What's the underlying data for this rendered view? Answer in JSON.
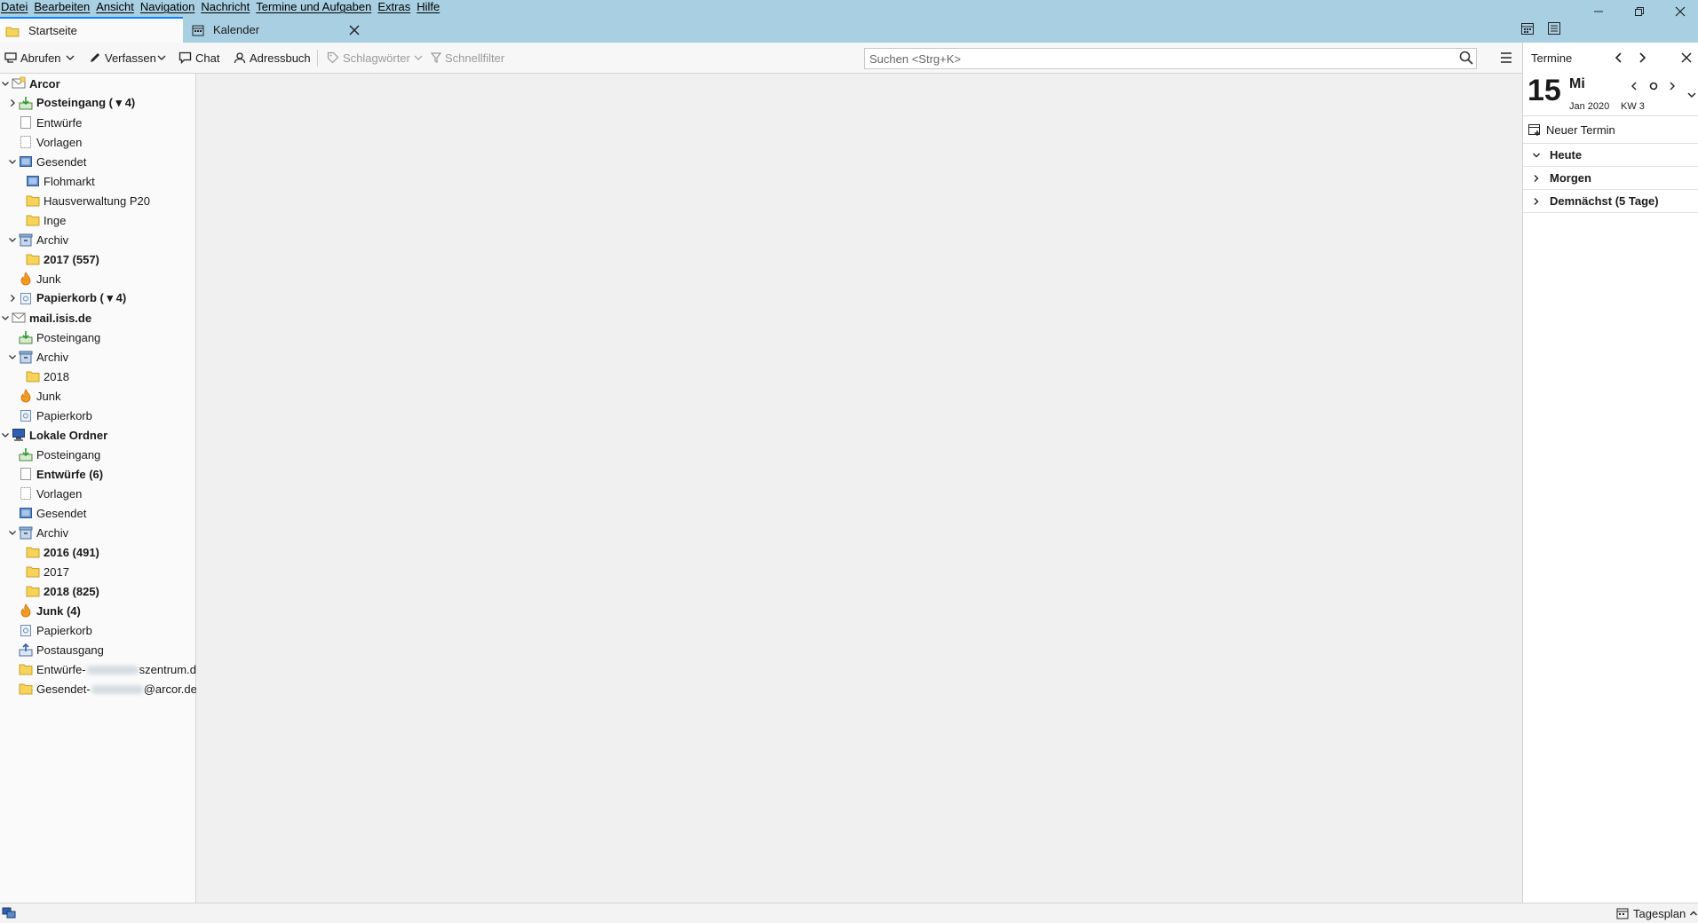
{
  "menu": [
    "Datei",
    "Bearbeiten",
    "Ansicht",
    "Navigation",
    "Nachricht",
    "Termine und Aufgaben",
    "Extras",
    "Hilfe"
  ],
  "tabs": [
    {
      "label": "Startseite",
      "icon": "folder-icon"
    },
    {
      "label": "Kalender",
      "icon": "calendar-icon"
    }
  ],
  "toolbar": {
    "abrufen": "Abrufen",
    "verfassen": "Verfassen",
    "chat": "Chat",
    "adressbuch": "Adressbuch",
    "schlagwoerter": "Schlagwörter",
    "schnellfilter": "Schnellfilter"
  },
  "search": {
    "placeholder": "Suchen <Strg+K>"
  },
  "folders": [
    {
      "label": "Arcor",
      "bold": true
    },
    {
      "label": "Posteingang ( ▾ 4)",
      "bold": true
    },
    {
      "label": "Entwürfe",
      "bold": false
    },
    {
      "label": "Vorlagen",
      "bold": false
    },
    {
      "label": "Gesendet",
      "bold": false
    },
    {
      "label": "Flohmarkt",
      "bold": false
    },
    {
      "label": "Hausverwaltung P20",
      "bold": false
    },
    {
      "label": "Inge",
      "bold": false
    },
    {
      "label": "Archiv",
      "bold": false
    },
    {
      "label": "2017 (557)",
      "bold": true
    },
    {
      "label": "Junk",
      "bold": false
    },
    {
      "label": "Papierkorb ( ▾ 4)",
      "bold": true
    },
    {
      "label": "mail.isis.de",
      "bold": true
    },
    {
      "label": "Posteingang",
      "bold": false
    },
    {
      "label": "Archiv",
      "bold": false
    },
    {
      "label": "2018",
      "bold": false
    },
    {
      "label": "Junk",
      "bold": false
    },
    {
      "label": "Papierkorb",
      "bold": false
    },
    {
      "label": "Lokale Ordner",
      "bold": true
    },
    {
      "label": "Posteingang",
      "bold": false
    },
    {
      "label": "Entwürfe (6)",
      "bold": true
    },
    {
      "label": "Vorlagen",
      "bold": false
    },
    {
      "label": "Gesendet",
      "bold": false
    },
    {
      "label": "Archiv",
      "bold": false
    },
    {
      "label": "2016 (491)",
      "bold": true
    },
    {
      "label": "2017",
      "bold": false
    },
    {
      "label": "2018 (825)",
      "bold": true
    },
    {
      "label": "Junk (4)",
      "bold": true
    },
    {
      "label": "Papierkorb",
      "bold": false
    },
    {
      "label": "Postausgang",
      "bold": false
    },
    {
      "label": "Entwürfe-",
      "suffix": "szentrum.de",
      "bold": false
    },
    {
      "label": "Gesendet-",
      "suffix": "@arcor.de",
      "bold": false
    }
  ],
  "today_pane": {
    "title": "Termine",
    "day_number": "15",
    "weekday": "Mi",
    "month_year": "Jan 2020",
    "week": "KW 3",
    "new_event": "Neuer Termin",
    "agenda": [
      "Heute",
      "Morgen",
      "Demnächst (5 Tage)"
    ]
  },
  "status": {
    "tagesplan": "Tagesplan"
  },
  "colors": {
    "titlebar": "#a8d0e2",
    "tab_accent": "#0a84ff",
    "folder": "#f7d35a"
  }
}
